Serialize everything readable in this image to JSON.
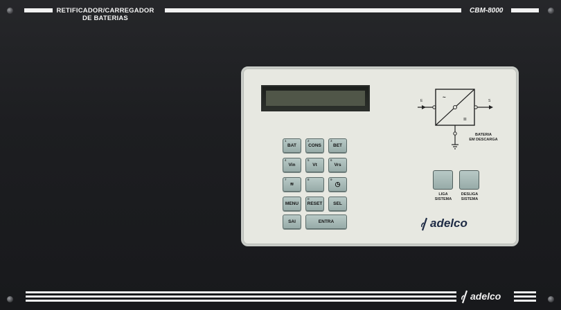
{
  "header": {
    "title_line1": "RETIFICADOR/CARREGADOR",
    "title_line2": "DE BATERIAS",
    "model": "CBM-8000"
  },
  "keypad": {
    "keys": [
      {
        "num": "1",
        "label": "BAT"
      },
      {
        "num": "2",
        "label": "CONS"
      },
      {
        "num": "3",
        "label": "BET"
      },
      {
        "num": "4",
        "label": "Vin"
      },
      {
        "num": "5",
        "label": "Vt"
      },
      {
        "num": "6",
        "label": "Vrs"
      },
      {
        "num": "7",
        "label": "≋"
      },
      {
        "num": "8",
        "label": ""
      },
      {
        "num": "9",
        "label": "◷"
      },
      {
        "num": "",
        "label": "MENU"
      },
      {
        "num": "0",
        "label": "RESET"
      },
      {
        "num": "",
        "label": "SEL"
      }
    ],
    "sai": "SAI",
    "entra": "ENTRA"
  },
  "diagram": {
    "input": "E",
    "output": "S",
    "ac_symbol": "~",
    "dc_symbol": "=",
    "battery_line1": "BATERIA",
    "battery_line2": "EM DESCARGA"
  },
  "controls": {
    "on_line1": "LIGA",
    "on_line2": "SISTEMA",
    "off_line1": "DESLIGA",
    "off_line2": "SISTEMA"
  },
  "brand": {
    "panel_logo": "adelco",
    "footer_logo": "adelco"
  },
  "colors": {
    "cabinet": "#1d1e21",
    "panel": "#e7e8e1",
    "keys": "#a8bbb8",
    "brand": "#1d2a44"
  }
}
